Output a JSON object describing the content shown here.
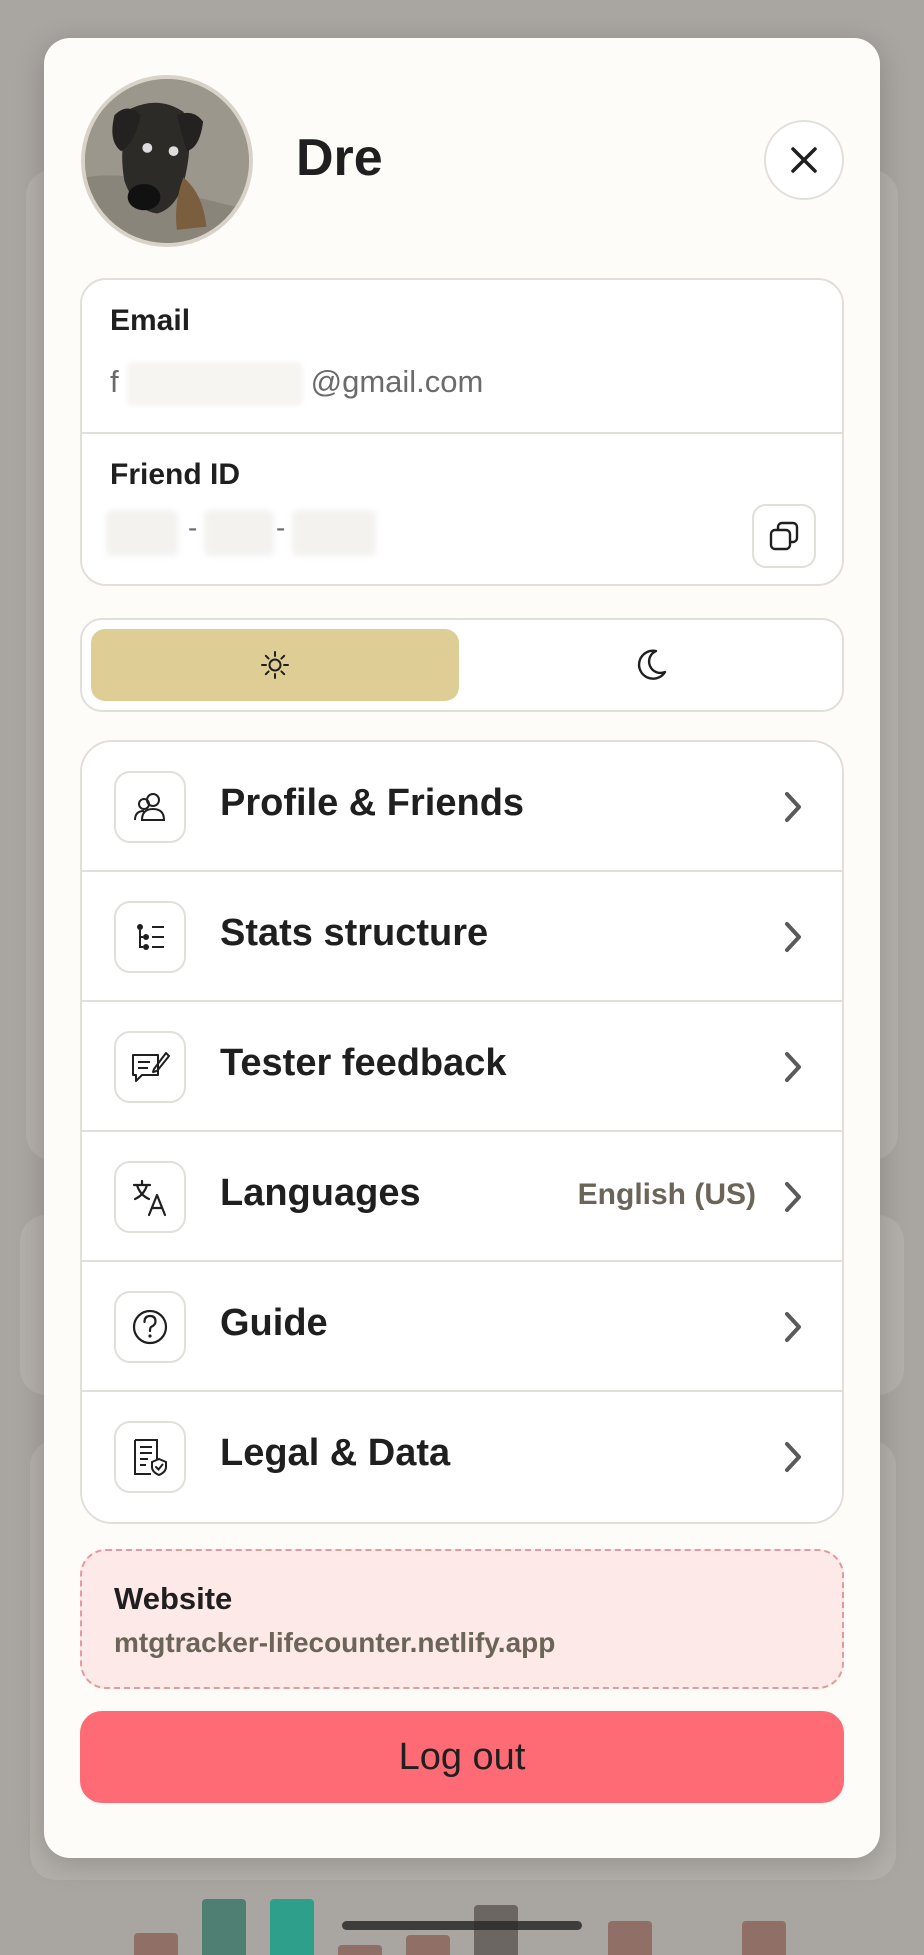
{
  "profile": {
    "name": "Dre",
    "email_prefix": "f",
    "email_suffix": "@gmail.com",
    "email_label": "Email",
    "friend_id_label": "Friend ID",
    "friend_id_sep": "-"
  },
  "theme": {
    "selected": "light",
    "options": [
      "light",
      "dark"
    ],
    "accent": "#dfcd96"
  },
  "menu": [
    {
      "label": "Profile & Friends",
      "icon": "users-icon",
      "value": ""
    },
    {
      "label": "Stats structure",
      "icon": "tree-list-icon",
      "value": ""
    },
    {
      "label": "Tester feedback",
      "icon": "feedback-icon",
      "value": ""
    },
    {
      "label": "Languages",
      "icon": "translate-icon",
      "value": "English (US)"
    },
    {
      "label": "Guide",
      "icon": "help-icon",
      "value": ""
    },
    {
      "label": "Legal & Data",
      "icon": "legal-shield-icon",
      "value": ""
    }
  ],
  "website": {
    "label": "Website",
    "url": "mtgtracker-lifecounter.netlify.app"
  },
  "logout_label": "Log out",
  "colors": {
    "logout": "#ff6b74",
    "website_bg": "#fde9e7"
  }
}
